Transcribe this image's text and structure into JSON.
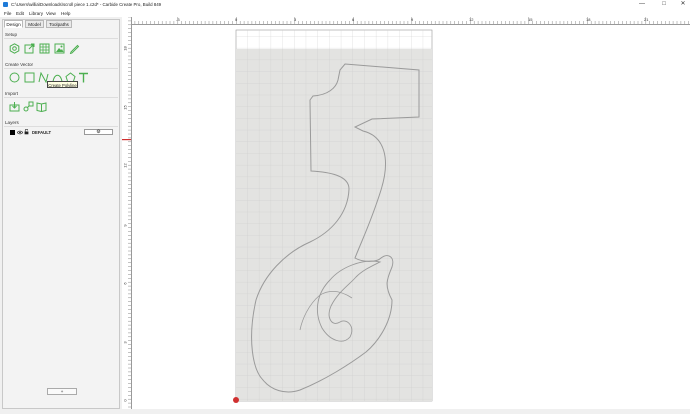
{
  "window": {
    "title": "C:\\Users\\willia\\Downloads\\scroll piece 1.c2d* - Carbide Create Pro, Build 849",
    "minimize": "—",
    "maximize": "□",
    "close": "✕"
  },
  "menu": [
    "File",
    "Edit",
    "Library",
    "View",
    "Help"
  ],
  "tabs": [
    "Design",
    "Model",
    "Toolpaths"
  ],
  "sections": {
    "setup": "Setup",
    "create_vector": "Create Vector",
    "import": "Import",
    "layers": "Layers"
  },
  "setup_icons": [
    "job-setup-icon",
    "workpiece-icon",
    "grid-icon",
    "image-icon",
    "pencil-icon"
  ],
  "vector_icons": [
    "circle-icon",
    "rectangle-icon",
    "polyline-icon",
    "curve-icon",
    "polygon-icon",
    "text-icon"
  ],
  "import_icons": [
    "import-file-icon",
    "import-svg-icon",
    "library-book-icon"
  ],
  "tooltip": "Create Polyline",
  "layers": [
    {
      "name": "DEFAULT",
      "color": "#000000",
      "visible": true,
      "locked": false,
      "current": true
    }
  ],
  "layer_settings_glyph": "⚙",
  "add_layer_label": "+",
  "ruler": {
    "top_labels": [
      "-3",
      "0",
      "3",
      "6",
      "9",
      "12",
      "15",
      "18",
      "21"
    ],
    "left_labels": [
      "18",
      "15",
      "12",
      "9",
      "6",
      "3",
      "0"
    ]
  },
  "colors": {
    "accent_green": "#4caf50",
    "stock": "#e3e3e1",
    "vector_line": "#9a9a9a",
    "ruler_marker": "#d03030"
  }
}
